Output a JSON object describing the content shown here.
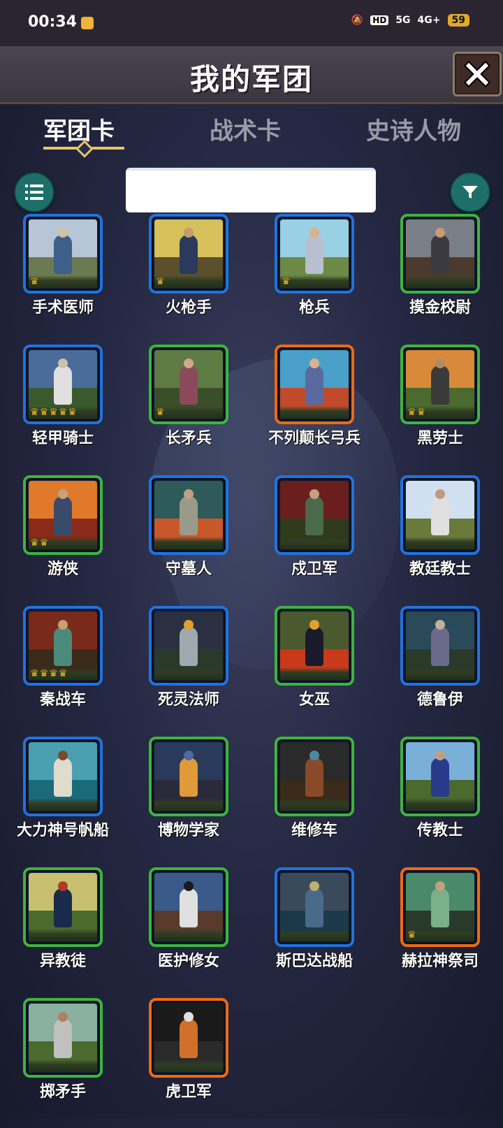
{
  "status": {
    "time": "00:34",
    "network_labels": [
      "HD",
      "5G",
      "4G+"
    ],
    "battery": "59"
  },
  "header": {
    "title": "我的军团"
  },
  "tabs": [
    {
      "label": "军团卡",
      "active": true
    },
    {
      "label": "战术卡",
      "active": false
    },
    {
      "label": "史诗人物",
      "active": false
    }
  ],
  "search": {
    "value": "",
    "placeholder": ""
  },
  "colors": {
    "frame_blue": "#2073e0",
    "frame_green": "#3db53d",
    "frame_orange": "#ef6a12",
    "crown": "#f2c230",
    "accent_teal": "#1e6f6a",
    "tab_underline": "#e9c46a"
  },
  "cards": [
    {
      "name": "手术医师",
      "rarity": "blue",
      "crowns": 1,
      "palette": [
        "#b7c6d6",
        "#6c7a52",
        "#3d5f8a",
        "#d8c0a0"
      ]
    },
    {
      "name": "火枪手",
      "rarity": "blue",
      "crowns": 1,
      "palette": [
        "#d6c15a",
        "#5c4f2b",
        "#2b3a5c",
        "#c79c6a"
      ]
    },
    {
      "name": "枪兵",
      "rarity": "blue",
      "crowns": 1,
      "palette": [
        "#9ad0e4",
        "#6c8a46",
        "#b7bfd0",
        "#d9b28c"
      ]
    },
    {
      "name": "摸金校尉",
      "rarity": "green",
      "crowns": 0,
      "palette": [
        "#7a7e86",
        "#4a3b2e",
        "#3b3a40",
        "#c89a72"
      ]
    },
    {
      "name": "轻甲骑士",
      "rarity": "blue",
      "crowns": 5,
      "palette": [
        "#4a6c9a",
        "#3a5a2e",
        "#e0e0e0",
        "#cfc0a8"
      ]
    },
    {
      "name": "长矛兵",
      "rarity": "green",
      "crowns": 1,
      "palette": [
        "#5e7b44",
        "#3b4e2a",
        "#8a4a5a",
        "#d2a888"
      ]
    },
    {
      "name": "不列颠长弓兵",
      "rarity": "orange",
      "crowns": 0,
      "palette": [
        "#4aa0c8",
        "#c04a2a",
        "#5a6aa0",
        "#d9b28c"
      ]
    },
    {
      "name": "黑劳士",
      "rarity": "green",
      "crowns": 2,
      "palette": [
        "#d88a3a",
        "#4a6a2e",
        "#3a3a3a",
        "#b08a6a"
      ]
    },
    {
      "name": "游侠",
      "rarity": "green",
      "crowns": 2,
      "palette": [
        "#e07a2a",
        "#8a2a1a",
        "#3a4a6a",
        "#c9a080"
      ]
    },
    {
      "name": "守墓人",
      "rarity": "blue",
      "crowns": 0,
      "palette": [
        "#2f5a5a",
        "#c8582a",
        "#9a9a8a",
        "#c0a080"
      ]
    },
    {
      "name": "戍卫军",
      "rarity": "blue",
      "crowns": 0,
      "palette": [
        "#6a1e1e",
        "#2e3a1a",
        "#4a6a4a",
        "#c0a080"
      ]
    },
    {
      "name": "教廷教士",
      "rarity": "blue",
      "crowns": 0,
      "palette": [
        "#d0e0f0",
        "#6a7a3a",
        "#e0e0e0",
        "#c09a80"
      ]
    },
    {
      "name": "秦战车",
      "rarity": "blue",
      "crowns": 4,
      "palette": [
        "#7a2a1a",
        "#3a2a1a",
        "#4a8a7a",
        "#c8a070"
      ]
    },
    {
      "name": "死灵法师",
      "rarity": "blue",
      "crowns": 0,
      "palette": [
        "#2a3040",
        "#2a3a2a",
        "#a0a8b0",
        "#e0a030"
      ]
    },
    {
      "name": "女巫",
      "rarity": "green",
      "crowns": 0,
      "palette": [
        "#4a5a2e",
        "#c83a1a",
        "#1a1a2a",
        "#e0a030"
      ]
    },
    {
      "name": "德鲁伊",
      "rarity": "blue",
      "crowns": 0,
      "palette": [
        "#2a4a5a",
        "#2a3a2a",
        "#6a6a8a",
        "#c0b0a0"
      ]
    },
    {
      "name": "大力神号帆船",
      "rarity": "blue",
      "crowns": 0,
      "palette": [
        "#4aa0b0",
        "#1a6a7a",
        "#e0dccc",
        "#7a4a2a"
      ]
    },
    {
      "name": "博物学家",
      "rarity": "green",
      "crowns": 0,
      "palette": [
        "#2a3a5a",
        "#2a2a3a",
        "#e09a3a",
        "#4a6aa0"
      ]
    },
    {
      "name": "维修车",
      "rarity": "green",
      "crowns": 0,
      "palette": [
        "#2a2a2a",
        "#3a2a1a",
        "#8a4a2a",
        "#4a8aa0"
      ]
    },
    {
      "name": "传教士",
      "rarity": "green",
      "crowns": 0,
      "palette": [
        "#7ab0d8",
        "#4a6a2e",
        "#2a3a8a",
        "#c0a080"
      ]
    },
    {
      "name": "异教徒",
      "rarity": "green",
      "crowns": 0,
      "palette": [
        "#c8c070",
        "#4a6a2e",
        "#1a2a4a",
        "#b03a2a"
      ]
    },
    {
      "name": "医护修女",
      "rarity": "green",
      "crowns": 0,
      "palette": [
        "#3a5a8a",
        "#5a3a2a",
        "#e0e0e0",
        "#1a1a1a"
      ]
    },
    {
      "name": "斯巴达战船",
      "rarity": "blue",
      "crowns": 0,
      "palette": [
        "#3a4a5a",
        "#1a3a4a",
        "#4a6a8a",
        "#c0b070"
      ]
    },
    {
      "name": "赫拉神祭司",
      "rarity": "orange",
      "crowns": 1,
      "palette": [
        "#4a8a6a",
        "#2a3a2a",
        "#7ab08a",
        "#c0a080"
      ]
    },
    {
      "name": "掷矛手",
      "rarity": "green",
      "crowns": 0,
      "palette": [
        "#8ab0a0",
        "#4a6a2e",
        "#c0c0c0",
        "#b08060"
      ]
    },
    {
      "name": "虎卫军",
      "rarity": "orange",
      "crowns": 0,
      "palette": [
        "#1a1a1a",
        "#2a2a2a",
        "#d0702a",
        "#e0e0e0"
      ]
    }
  ]
}
